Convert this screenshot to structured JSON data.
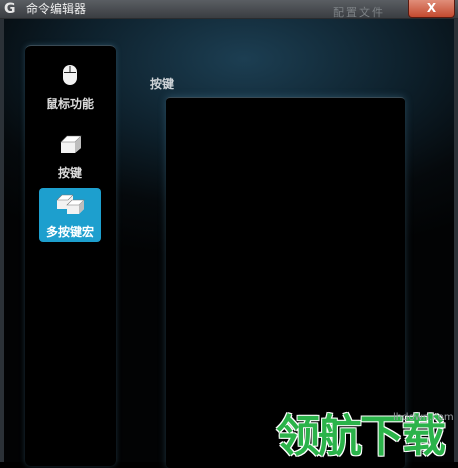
{
  "window": {
    "title": "命令编辑器",
    "ghost_title": "配置文件",
    "close_label": "X"
  },
  "nav": {
    "items": [
      {
        "label": "鼠标功能",
        "icon": "mouse-icon",
        "active": false
      },
      {
        "label": "按键",
        "icon": "key-icon",
        "active": false
      },
      {
        "label": "多按键宏",
        "icon": "multi-key-icon",
        "active": true
      }
    ]
  },
  "main": {
    "section_label": "按键"
  },
  "watermark": {
    "text": "领航下载",
    "url": "lhdown.com"
  },
  "colors": {
    "accent": "#1d9fce",
    "close": "#c44a2f",
    "watermark": "#2bb34a"
  }
}
